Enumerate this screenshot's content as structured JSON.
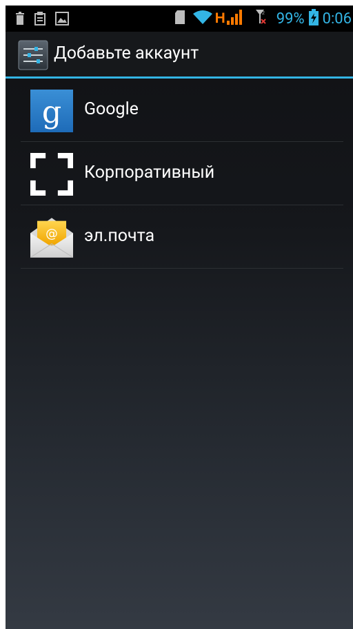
{
  "status_bar": {
    "battery": "99%",
    "time": "0:06",
    "network": "H",
    "left_icons": [
      "trash-icon",
      "clipboard-icon",
      "image-icon"
    ],
    "right_icons": [
      "sd-card-icon",
      "wifi-icon",
      "signal-icon",
      "sim-icon",
      "battery-icon"
    ]
  },
  "action_bar": {
    "title": "Добавьте аккаунт",
    "icon": "settings-icon"
  },
  "accounts": [
    {
      "label": "Google",
      "icon": "google-icon"
    },
    {
      "label": "Корпоративный",
      "icon": "corporate-icon"
    },
    {
      "label": "эл.почта",
      "icon": "email-icon"
    }
  ],
  "colors": {
    "accent": "#33b5e5",
    "network_indicator": "#ff7a00"
  }
}
